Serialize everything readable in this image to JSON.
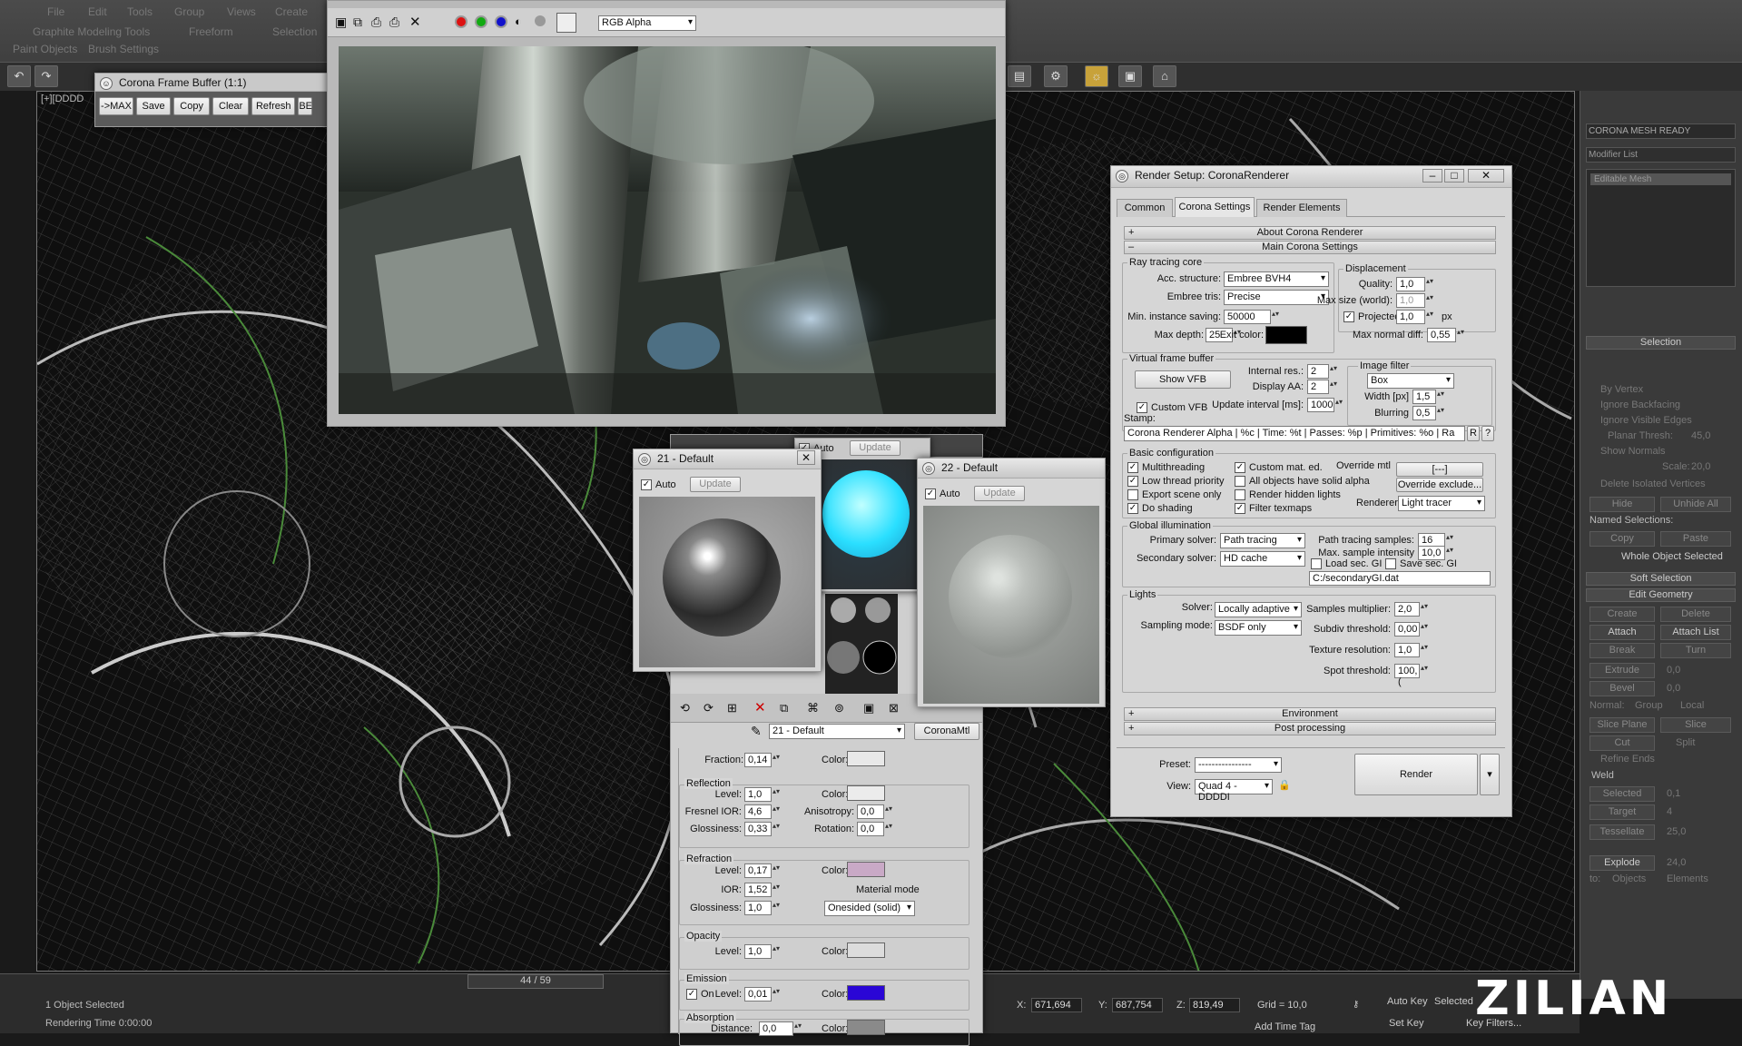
{
  "max": {
    "menu": [
      "File",
      "Edit",
      "Tools",
      "Group",
      "Views",
      "Create"
    ],
    "ribbon_tabs": [
      "Graphite Modeling Tools",
      "Freeform",
      "Selection"
    ],
    "ribbon_sub": [
      "Paint Objects",
      "Brush Settings"
    ],
    "viewport_label": "[+][DDDD",
    "frame_counter": "44 / 59",
    "status_selected": "1 Object Selected",
    "render_time": "Rendering Time  0:00:00",
    "coords": {
      "x": "671,694",
      "y": "687,754",
      "z": "819,49",
      "grid": "Grid = 10,0"
    },
    "auto_key": "Auto Key",
    "selected": "Selected",
    "set_key": "Set Key",
    "key_filters": "Key Filters...",
    "add_time_tag": "Add Time Tag",
    "logo": "ZILIAN"
  },
  "fb": {
    "title": "Corona Frame Buffer (1:1)",
    "channel": "RGB Alpha",
    "buttons": [
      "->MAX",
      "Save",
      "Copy",
      "Clear",
      "Refresh",
      "BE"
    ]
  },
  "mat21": {
    "title": "21 - Default",
    "auto": "Auto",
    "update": "Update"
  },
  "mat22": {
    "title": "22 - Default",
    "auto": "Auto",
    "update": "Update"
  },
  "matmid": {
    "auto": "Auto",
    "update": "Update"
  },
  "mated": {
    "material_name": "21 - Default",
    "material_type": "CoronaMtl",
    "fraction_label": "Fraction:",
    "fraction": "0,14",
    "color_label": "Color:",
    "reflection": {
      "title": "Reflection",
      "level_label": "Level:",
      "level": "1,0",
      "color_label": "Color:",
      "fresnel_label": "Fresnel IOR:",
      "fresnel": "4,6",
      "aniso_label": "Anisotropy:",
      "aniso": "0,0",
      "gloss_label": "Glossiness:",
      "gloss": "0,33",
      "rot_label": "Rotation:",
      "rot": "0,0"
    },
    "refraction": {
      "title": "Refraction",
      "level_label": "Level:",
      "level": "0,17",
      "color_label": "Color:",
      "ior_label": "IOR:",
      "ior": "1,52",
      "gloss_label": "Glossiness:",
      "gloss": "1,0",
      "mode_label": "Material mode",
      "mode": "Onesided (solid)"
    },
    "opacity": {
      "title": "Opacity",
      "level_label": "Level:",
      "level": "1,0",
      "color_label": "Color:"
    },
    "emission": {
      "title": "Emission",
      "on": "On",
      "level_label": "Level:",
      "level": "0,01",
      "color_label": "Color:"
    },
    "absorption": {
      "title": "Absorption",
      "dist_label": "Distance:",
      "dist": "0,0",
      "color_label": "Color:"
    }
  },
  "rs": {
    "title": "Render Setup: CoronaRenderer",
    "tabs": [
      "Common",
      "Corona Settings",
      "Render Elements"
    ],
    "about": "About Corona Renderer",
    "main": "Main Corona Settings",
    "rt_core": "Ray tracing core",
    "acc_label": "Acc. structure:",
    "acc": "Embree BVH4",
    "tris_label": "Embree tris:",
    "tris": "Precise",
    "mininst_label": "Min. instance saving:",
    "mininst": "50000",
    "maxdepth_label": "Max depth:",
    "maxdepth": "25",
    "exit_label": "Exit color:",
    "disp": "Displacement",
    "quality_label": "Quality:",
    "quality": "1,0",
    "maxsize_label": "Max size (world):",
    "maxsize": "1,0",
    "projsize_label": "Projected size",
    "projsize": "1,0",
    "px": "px",
    "maxnormal_label": "Max normal diff:",
    "maxnormal": "0,55",
    "vfb": "Virtual frame buffer",
    "show_vfb": "Show VFB",
    "custom_vfb": "Custom VFB",
    "internal_label": "Internal res.:",
    "internal": "2",
    "dispaa_label": "Display AA:",
    "dispaa": "2",
    "update_label": "Update interval [ms]:",
    "update": "1000",
    "img_filter": "Image filter",
    "filter": "Box",
    "width_label": "Width [px]",
    "width": "1,5",
    "blur_label": "Blurring",
    "blur": "0,5",
    "stamp_label": "Stamp:",
    "stamp": "Corona Renderer Alpha | %c | Time: %t | Passes: %p | Primitives: %o | Ra",
    "stamp_r": "R",
    "stamp_q": "?",
    "basic": "Basic configuration",
    "chk_multi": "Multithreading",
    "chk_low": "Low thread priority",
    "chk_export": "Export scene only",
    "chk_shading": "Do shading",
    "chk_custom": "Custom mat. ed.",
    "chk_alpha": "All objects have solid alpha",
    "chk_hidden": "Render hidden lights",
    "chk_filter": "Filter texmaps",
    "override_label": "Override mtl",
    "override_btn": "[---]",
    "override_ex": "Override exclude...",
    "renderer_label": "Renderer",
    "renderer": "Light tracer",
    "gi": "Global illumination",
    "primary_label": "Primary solver:",
    "primary": "Path tracing",
    "secondary_label": "Secondary solver:",
    "secondary": "HD cache",
    "pts_label": "Path tracing samples:",
    "pts": "16",
    "maxint_label": "Max. sample intensity",
    "maxint": "10,0",
    "loadgi": "Load sec. GI",
    "savegi": "Save sec. GI",
    "gi_path": "C:/secondaryGI.dat",
    "lights": "Lights",
    "solver_label": "Solver:",
    "solver": "Locally adaptive",
    "sampling_label": "Sampling mode:",
    "sampling": "BSDF only",
    "smult_label": "Samples multiplier:",
    "smult": "2,0",
    "subdiv_label": "Subdiv threshold:",
    "subdiv": "0,00",
    "texres_label": "Texture resolution:",
    "texres": "1,0",
    "spot_label": "Spot threshold:",
    "spot": "100,(",
    "environment": "Environment",
    "post": "Post processing",
    "preset_label": "Preset:",
    "preset": "----------------",
    "view_label": "View:",
    "view": "Quad 4 - DDDDI",
    "render": "Render"
  },
  "rp": {
    "object_name": "CORONA MESH READY",
    "modifier_list": "Modifier List",
    "editable_mesh": "Editable Mesh",
    "selection": "Selection",
    "by_vertex": "By Vertex",
    "ignore_bf": "Ignore Backfacing",
    "ignore_ve": "Ignore Visible Edges",
    "planar_label": "Planar Thresh:",
    "planar": "45,0",
    "show_normals": "Show Normals",
    "scale_label": "Scale:",
    "scale": "20,0",
    "del_iso": "Delete Isolated Vertices",
    "hide": "Hide",
    "unhide": "Unhide All",
    "named_sel": "Named Selections:",
    "copy": "Copy",
    "paste": "Paste",
    "whole": "Whole Object Selected",
    "soft": "Soft Selection",
    "edit_geo": "Edit Geometry",
    "create": "Create",
    "delete": "Delete",
    "attach": "Attach",
    "attach_list": "Attach List",
    "break": "Break",
    "turn": "Turn",
    "extrude": "Extrude",
    "extrude_v": "0,0",
    "bevel": "Bevel",
    "bevel_v": "0,0",
    "normal": "Normal:",
    "group": "Group",
    "local": "Local",
    "slice_plane": "Slice Plane",
    "slice": "Slice",
    "cut": "Cut",
    "split": "Split",
    "refine": "Refine Ends",
    "weld": "Weld",
    "selected_b": "Selected",
    "selected_v": "0,1",
    "target_b": "Target",
    "target_v": "4",
    "tessellate": "Tessellate",
    "tess_v": "25,0",
    "explode": "Explode",
    "explode_v": "24,0",
    "to": "to:",
    "objects": "Objects",
    "elements": "Elements"
  },
  "colors": {
    "exit": "#000000",
    "fraction": "#e8e8e8",
    "reflect": "#ececec",
    "refract": "#c9a9c6",
    "opacity": "#dcdcdc",
    "emission": "#2a06d6",
    "absorb": "#8a8a8a"
  }
}
